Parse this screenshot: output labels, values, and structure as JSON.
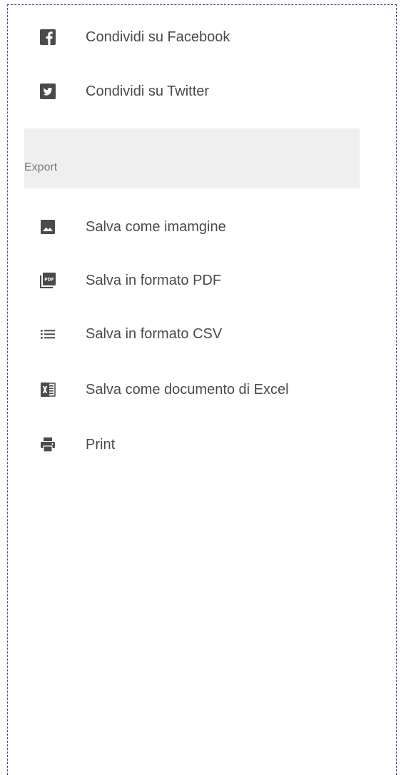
{
  "share": {
    "facebook": {
      "label": "Condividi su Facebook",
      "icon": "facebook-icon"
    },
    "twitter": {
      "label": "Condividi su Twitter",
      "icon": "twitter-icon"
    }
  },
  "export": {
    "header": "Export",
    "items": [
      {
        "label": "Salva come imamgine",
        "icon": "image-icon"
      },
      {
        "label": "Salva in formato PDF",
        "icon": "pdf-icon"
      },
      {
        "label": "Salva in formato CSV",
        "icon": "list-icon"
      },
      {
        "label": "Salva come documento di Excel",
        "icon": "excel-icon"
      },
      {
        "label": "Print",
        "icon": "printer-icon"
      }
    ]
  },
  "colors": {
    "icon": "#4a4a4a",
    "text": "#4a4a4a",
    "section_bg": "#efefef",
    "section_text": "#7a7a7a",
    "frame_border": "#3b4f9a"
  }
}
